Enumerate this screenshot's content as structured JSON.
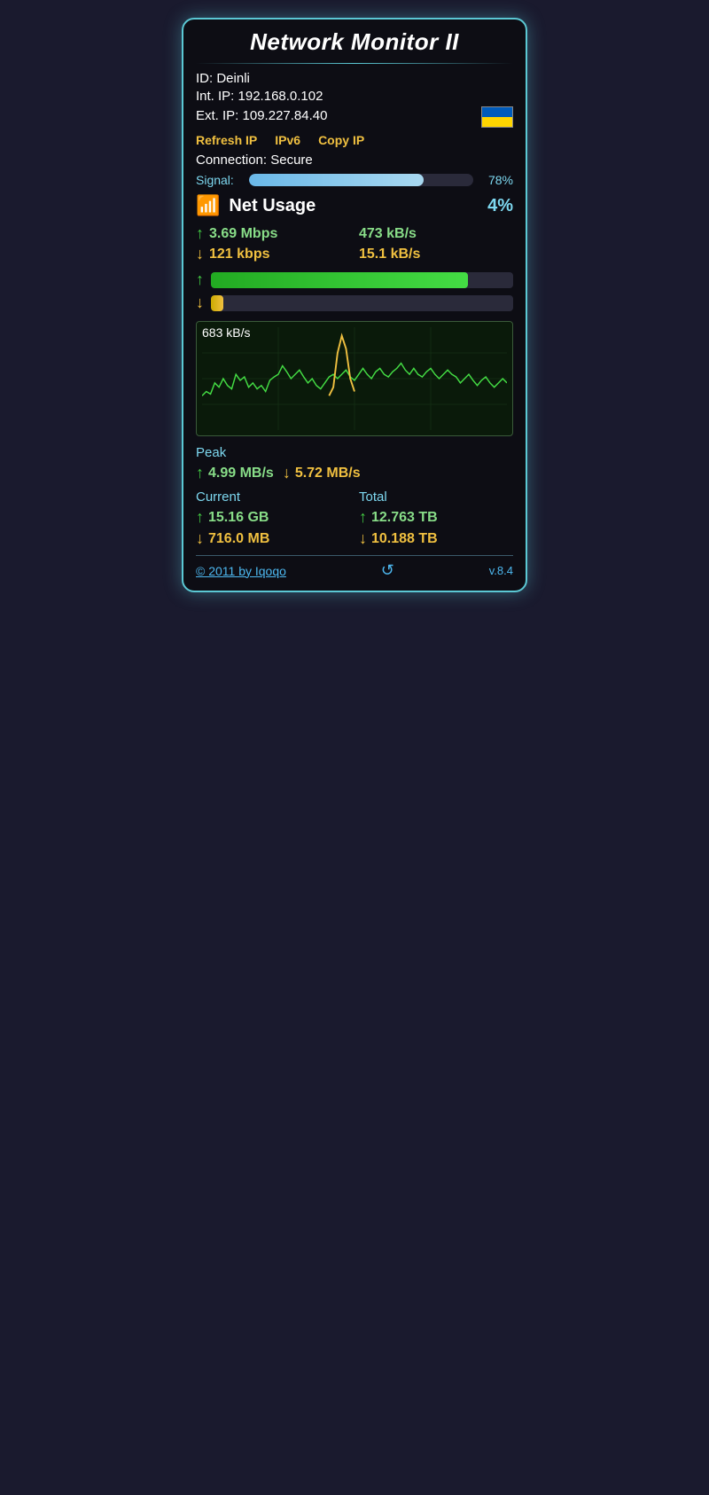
{
  "widget": {
    "title": "Network Monitor II",
    "id_label": "ID:",
    "id_value": "Deinli",
    "int_ip_label": "Int. IP:",
    "int_ip_value": "192.168.0.102",
    "ext_ip_label": "Ext. IP:",
    "ext_ip_value": "109.227.84.40",
    "actions": {
      "refresh": "Refresh IP",
      "ipv6": "IPv6",
      "copy": "Copy IP"
    },
    "connection_label": "Connection:",
    "connection_value": "Secure",
    "signal_label": "Signal:",
    "signal_pct": "78%",
    "signal_value": 78,
    "net_usage_label": "Net Usage",
    "net_usage_pct": "4%",
    "upload_mbps": "3.69 Mbps",
    "upload_kbs": "473 kB/s",
    "download_kbps": "121 kbps",
    "download_kbs": "15.1 kB/s",
    "upload_bar_pct": 85,
    "download_bar_pct": 4,
    "chart_label": "683 kB/s",
    "peak_title": "Peak",
    "peak_upload": "4.99 MB/s",
    "peak_download": "5.72 MB/s",
    "current_label": "Current",
    "total_label": "Total",
    "current_upload": "15.16 GB",
    "current_download": "716.0 MB",
    "total_upload": "12.763 TB",
    "total_download": "10.188 TB",
    "footer_link": "© 2011 by Iqoqo",
    "footer_version": "v.8.4"
  }
}
